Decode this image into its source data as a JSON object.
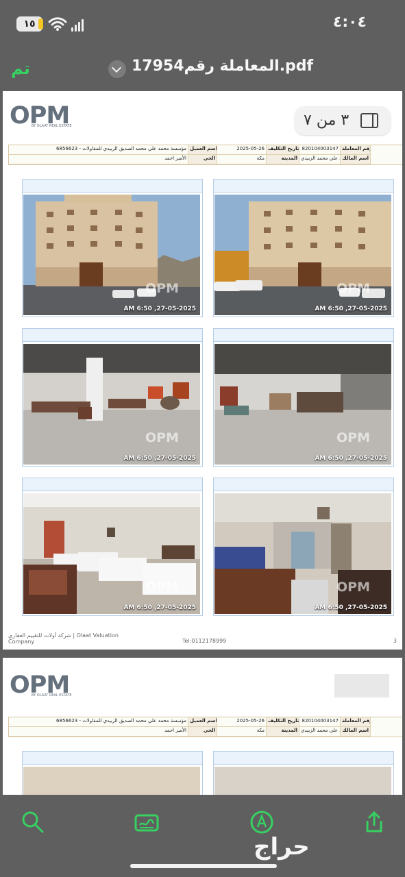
{
  "status_bar": {
    "time": "٤:٠٤",
    "battery": "١٥"
  },
  "navigation": {
    "done_label": "تم",
    "document_title": "المعاملة رقم17954.pdf"
  },
  "viewer": {
    "page_counter": "٣ من ٧"
  },
  "brand": {
    "logo_text": "OPM",
    "logo_subtitle": "BY OLAAT REAL ESTATE"
  },
  "info_table": {
    "transaction_number_label": "رقم المعاملة",
    "transaction_number": "820104003147",
    "assignment_date_label": "تاريخ التكليف",
    "assignment_date": "2025-05-26",
    "client_name_label": "اسم العميل",
    "client_name": "مؤسسة محمد علي محمد الصديق الزبيدي للمقاولات - 6856623",
    "owner_name_label": "اسم المالك",
    "owner_name": "محمد علي محمد الزبيدي",
    "city_label": "المدينة",
    "city": "مكة",
    "district_label": "الحي",
    "district": "الأمير احمد"
  },
  "photos": [
    {
      "timestamp": "AM 6:50 ,27-05-2025"
    },
    {
      "timestamp": "AM 6:50 ,27-05-2025"
    },
    {
      "timestamp": "AM 6:50 ,27-05-2025"
    },
    {
      "timestamp": "AM 6:50 ,27-05-2025"
    },
    {
      "timestamp": "AM 6:50 ,27-05-2025"
    },
    {
      "timestamp": "AM 6:50 ,27-05-2025"
    }
  ],
  "footer": {
    "company": "شركة أولات للتقييم العقاري | Olaat Valuation Company",
    "phone": "Tel:0112178999",
    "page_number": "3"
  },
  "bottom_watermark": "حراج",
  "colors": {
    "accent_green": "#37d161",
    "toolbar_bg": "#5f5f5f",
    "page_bg": "#ffffff"
  }
}
